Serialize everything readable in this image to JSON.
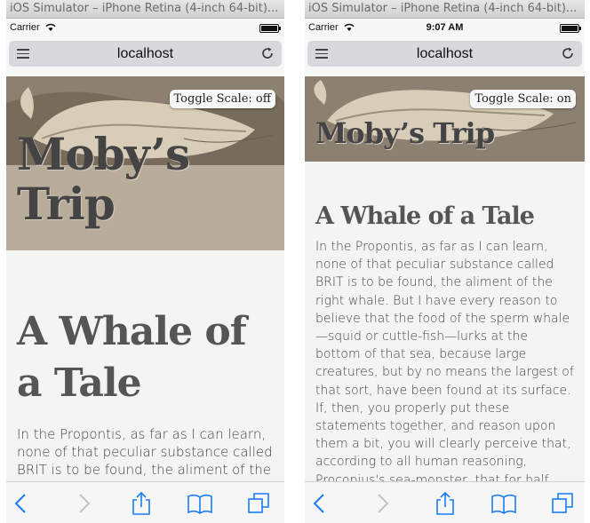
{
  "left": {
    "window_title": "iOS Simulator – iPhone Retina (4-inch 64-bit)...",
    "carrier": "Carrier",
    "time": "",
    "url": "localhost",
    "toggle_label": "Toggle Scale: off",
    "site_title": "Moby’s Trip",
    "article_heading": "A Whale of a Tale",
    "article_body": "In the Propontis, as far as I can learn, none of that peculiar substance called BRIT is to be found, the aliment of the right whale. But I have every reason to"
  },
  "right": {
    "window_title": "iOS Simulator – iPhone Retina (4-inch 64-bit)...",
    "carrier": "Carrier",
    "time": "9:07 AM",
    "url": "localhost",
    "toggle_label": "Toggle Scale: on",
    "site_title": "Moby’s Trip",
    "article_heading": "A Whale of a Tale",
    "article_body": "In the Propontis, as far as I can learn, none of that peculiar substance called BRIT is to be found, the aliment of the right whale. But I have every reason to believe that the food of the sperm whale—squid or cuttle-fish—lurks at the bottom of that sea, because large creatures, but by no means the largest of that sort, have been found at its surface. If, then, you properly put these statements together, and reason upon them a bit, you will clearly perceive that, according to all human reasoning, Procopius's sea-monster, that for half"
  },
  "toolbar_icons": [
    "back-icon",
    "forward-icon",
    "share-icon",
    "bookmarks-icon",
    "tabs-icon"
  ],
  "colors": {
    "accent": "#1a7cf5",
    "hero_bg": "#b8ac9a",
    "title_text": "#444444"
  }
}
